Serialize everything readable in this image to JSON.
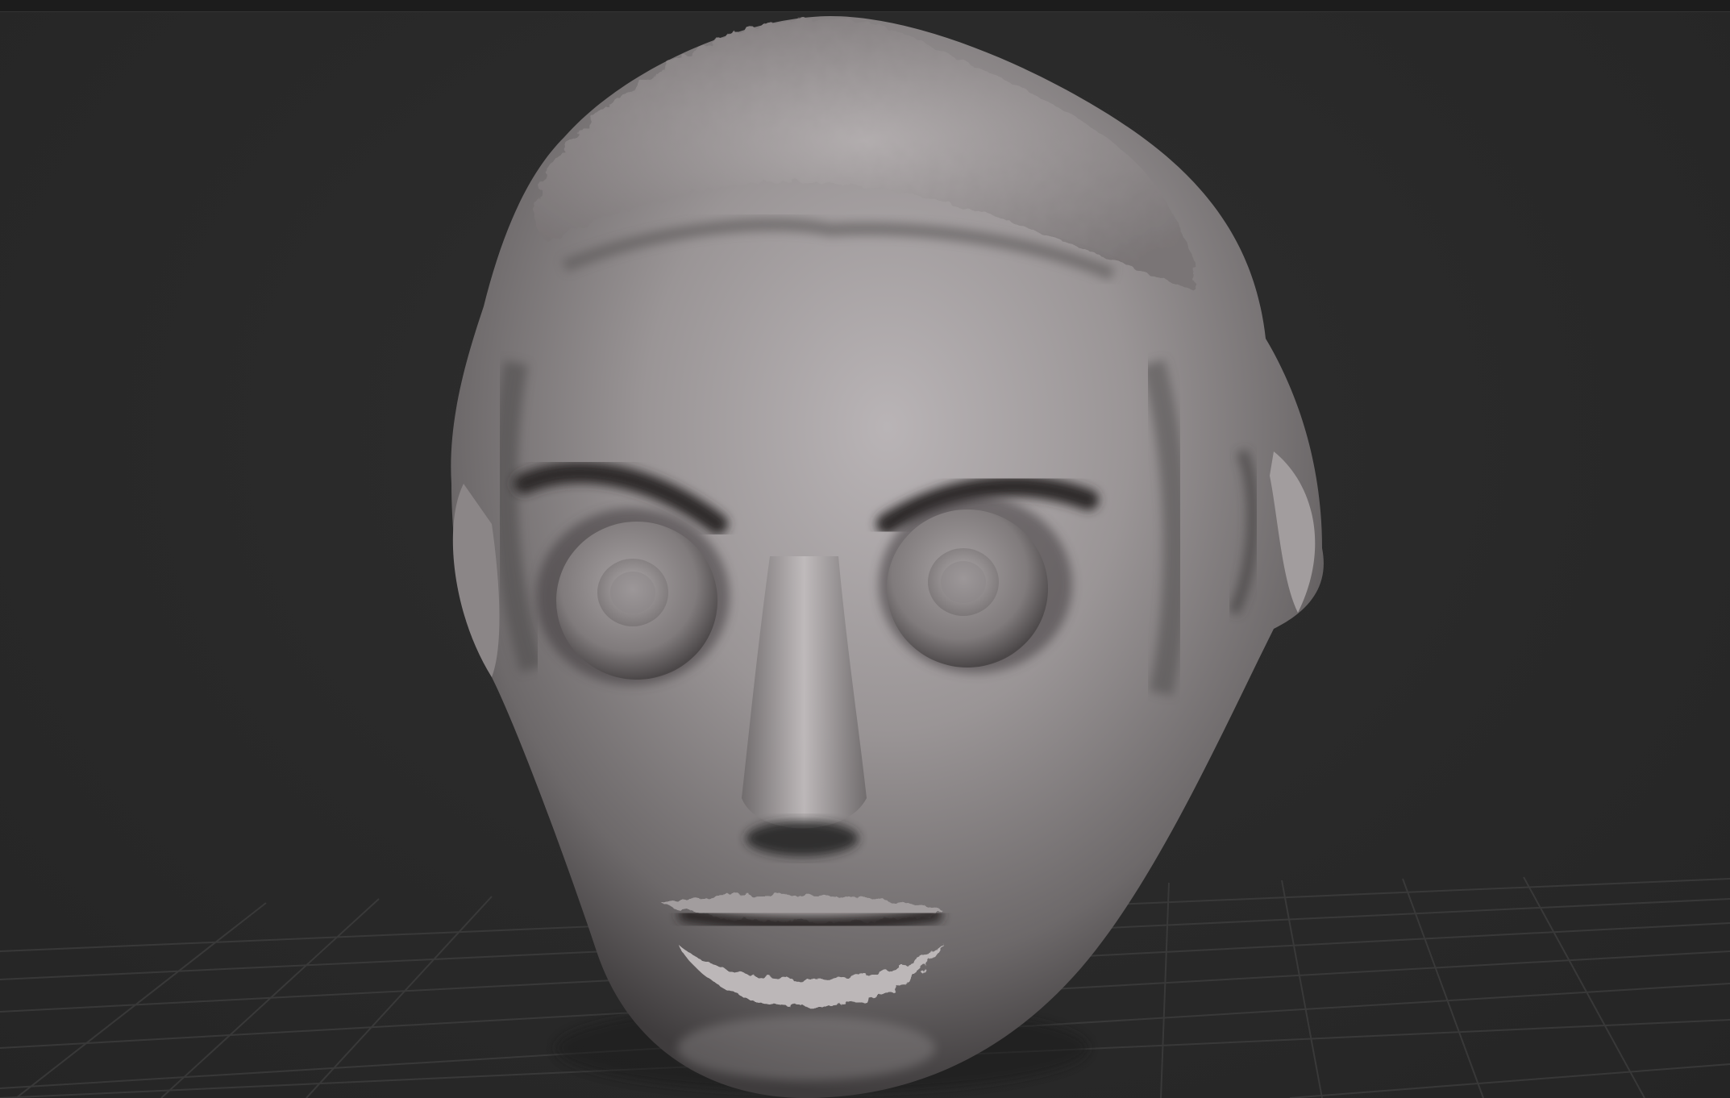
{
  "app": {
    "kind": "3d-sculpting-viewport"
  },
  "viewport": {
    "background_color": "#2a2a2a",
    "grid_color": "#3a3a3a",
    "model_color": "#a39fa0",
    "model_shadow_color": "#3a3839",
    "show_floor_grid": true
  }
}
